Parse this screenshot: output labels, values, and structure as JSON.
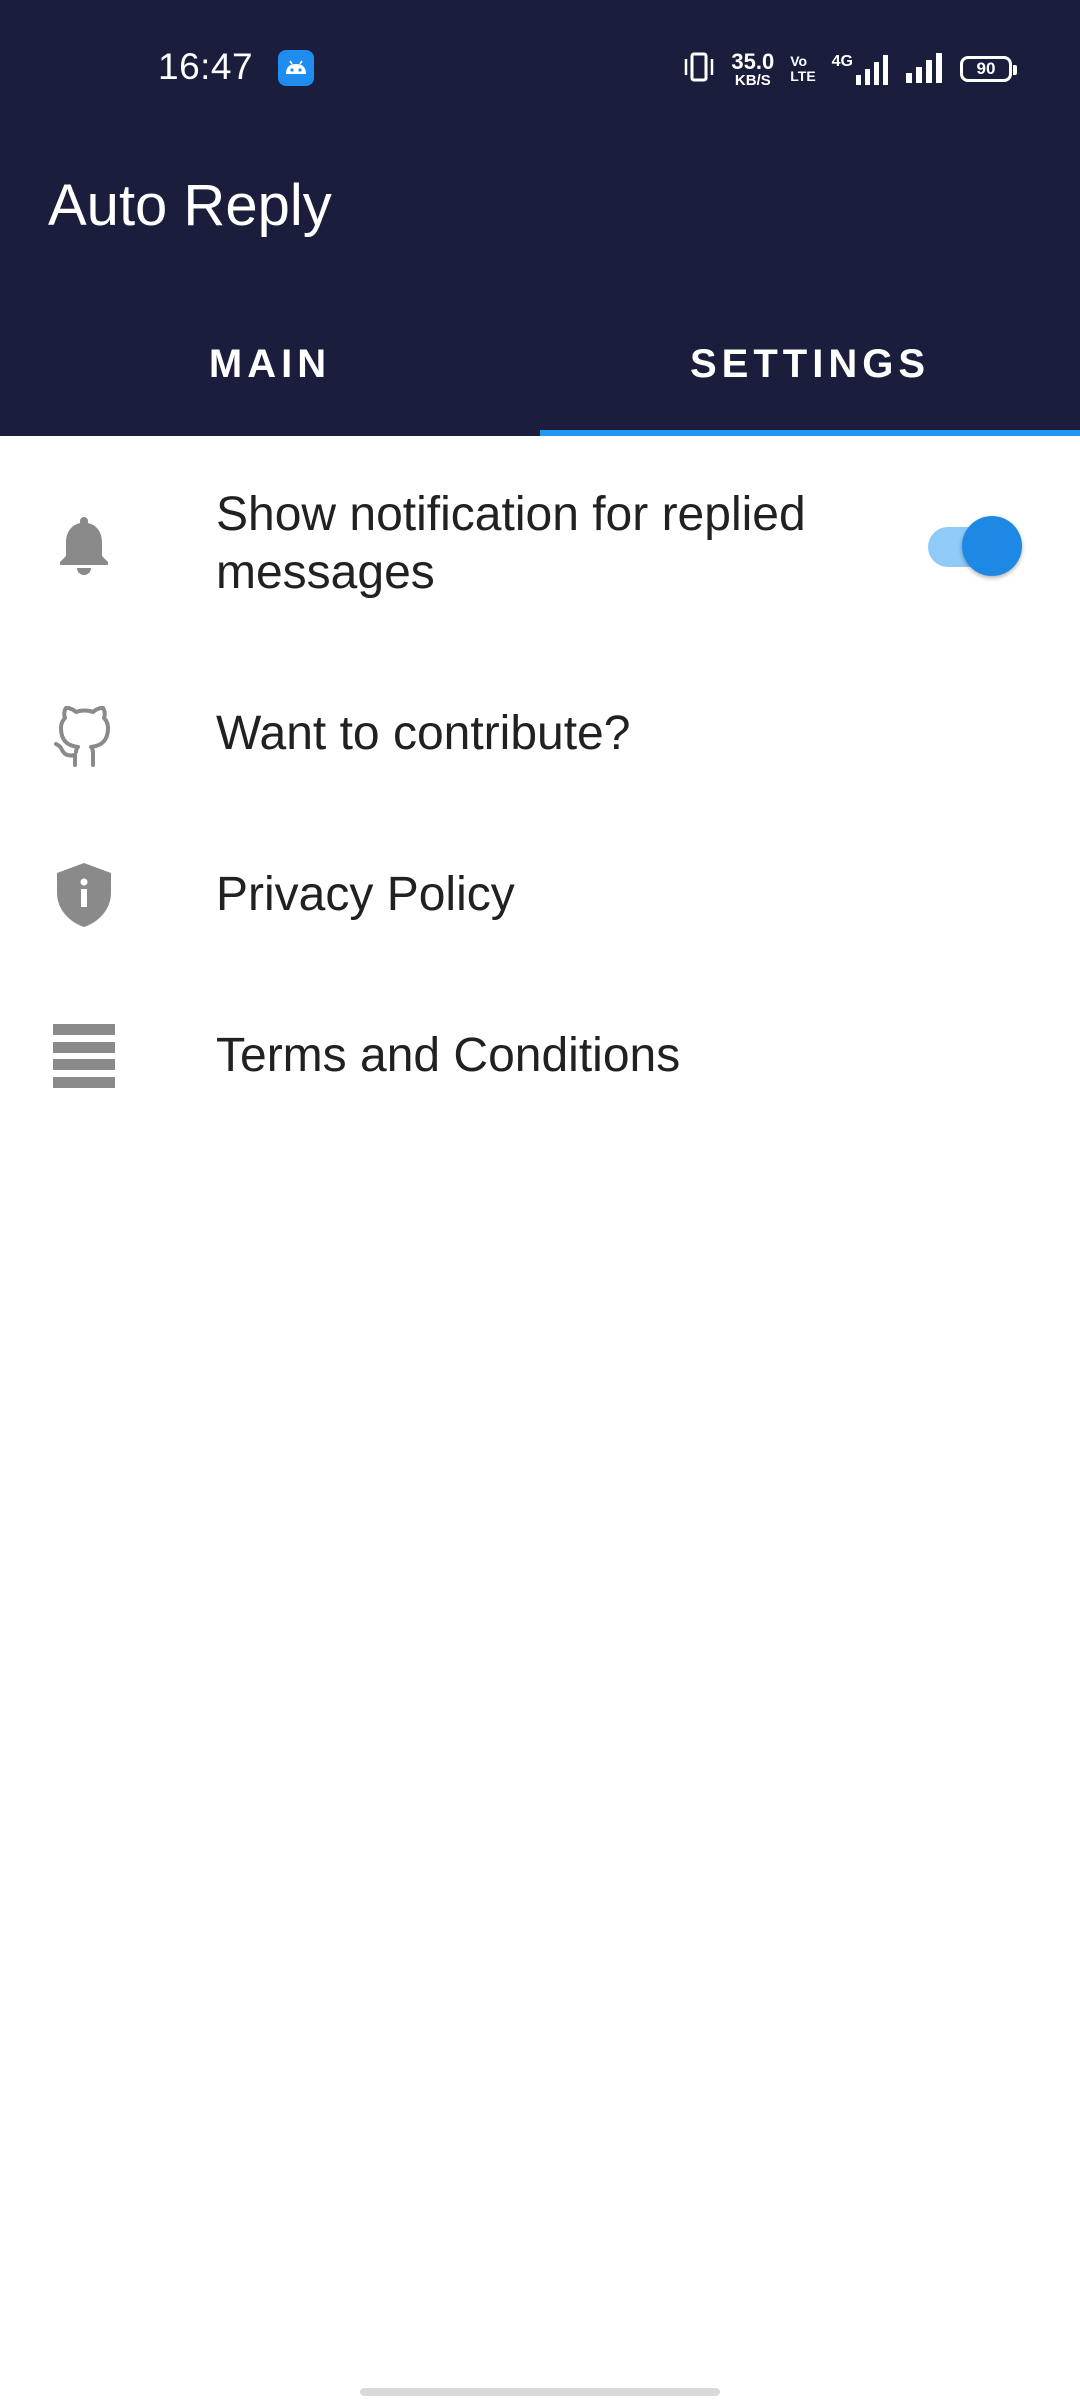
{
  "status_bar": {
    "time": "16:47",
    "net_speed_value": "35.0",
    "net_speed_unit": "KB/S",
    "volte_top": "Vo",
    "volte_bottom": "LTE",
    "network_type": "4G",
    "battery": "90"
  },
  "app_bar": {
    "title": "Auto Reply"
  },
  "tabs": [
    {
      "label": "MAIN",
      "active": false
    },
    {
      "label": "SETTINGS",
      "active": true
    }
  ],
  "settings": {
    "items": [
      {
        "icon": "bell-icon",
        "label": "Show notification for replied messages",
        "toggle": true
      },
      {
        "icon": "github-icon",
        "label": "Want to contribute?"
      },
      {
        "icon": "shield-info-icon",
        "label": "Privacy Policy"
      },
      {
        "icon": "list-icon",
        "label": "Terms and Conditions"
      }
    ]
  },
  "colors": {
    "app_bar": "#1b1d3c",
    "tab_indicator": "#2196f3",
    "toggle_thumb": "#1e88e5",
    "toggle_track": "#90caf9",
    "icon_gray": "#8a8a8a"
  }
}
